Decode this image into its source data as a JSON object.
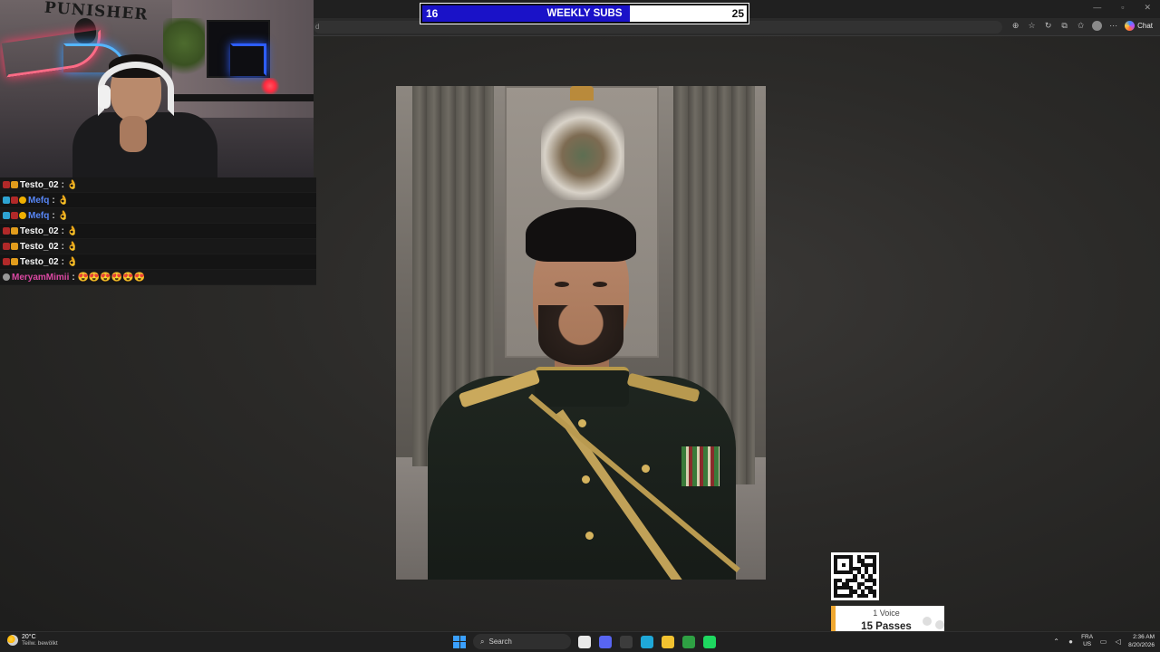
{
  "subs_bar": {
    "title": "WEEKLY SUBS",
    "current": "16",
    "goal": "25",
    "progress": 0.64,
    "fill_color": "#1a12c8"
  },
  "webcam": {
    "poster_text": "PUNISHER"
  },
  "browser": {
    "url_fragment": "d",
    "chat_label": "Chat",
    "icons": [
      "zoom-icon",
      "star-icon",
      "refresh-icon",
      "extensions-icon",
      "favorites-icon",
      "profile-icon",
      "more-icon"
    ]
  },
  "chat": {
    "messages": [
      {
        "user": "Testo_02",
        "user_color": "#ffffff",
        "badges": [
          "red",
          "gold"
        ],
        "message": "👌"
      },
      {
        "user": "Mefq",
        "user_color": "#5a8bff",
        "badges": [
          "blue",
          "red",
          "coin"
        ],
        "message": "👌"
      },
      {
        "user": "Mefq",
        "user_color": "#5a8bff",
        "badges": [
          "blue",
          "red",
          "coin"
        ],
        "message": "👌"
      },
      {
        "user": "Testo_02",
        "user_color": "#ffffff",
        "badges": [
          "red",
          "gold"
        ],
        "message": "👌"
      },
      {
        "user": "Testo_02",
        "user_color": "#ffffff",
        "badges": [
          "red",
          "gold"
        ],
        "message": "👌"
      },
      {
        "user": "Testo_02",
        "user_color": "#ffffff",
        "badges": [
          "red",
          "gold"
        ],
        "message": "👌"
      },
      {
        "user": "MeryamMimii",
        "user_color": "#e24aa8",
        "badges": [
          "grey"
        ],
        "message": "😍😍😍😍😍😍"
      }
    ]
  },
  "passes": {
    "voice": "1 Voice",
    "count": "15 Passes",
    "accent": "#f0a830"
  },
  "taskbar": {
    "weather_temp": "20°C",
    "weather_desc": "Teilw. bewölkt",
    "search_placeholder": "Search",
    "lang_top": "FRA",
    "lang_bottom": "US",
    "time": "2:36 AM",
    "date": "8/20/2026",
    "apps": [
      {
        "name": "file-explorer-taskbar-icon",
        "color": "#e9e9e9"
      },
      {
        "name": "discord-taskbar-icon",
        "color": "#5865f2"
      },
      {
        "name": "obs-taskbar-icon",
        "color": "#3c3c3c"
      },
      {
        "name": "edge-taskbar-icon",
        "color": "#1fa8d8"
      },
      {
        "name": "folder-taskbar-icon",
        "color": "#f2c230"
      },
      {
        "name": "xbox-taskbar-icon",
        "color": "#2ea043"
      },
      {
        "name": "spotify-taskbar-icon",
        "color": "#1ed760"
      }
    ]
  }
}
